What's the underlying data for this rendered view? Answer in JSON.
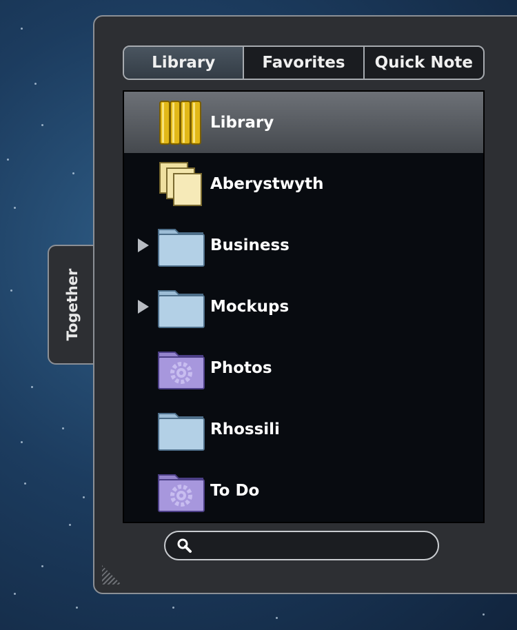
{
  "side_tab": {
    "label": "Together"
  },
  "segments": [
    {
      "label": "Library",
      "selected": true
    },
    {
      "label": "Favorites"
    },
    {
      "label": "Quick Note"
    }
  ],
  "items": [
    {
      "label": "Library",
      "icon": "library-icon",
      "selected": true,
      "expandable": false
    },
    {
      "label": "Aberystwyth",
      "icon": "stacked-notes-icon",
      "expandable": false
    },
    {
      "label": "Business",
      "icon": "blue-folder-icon",
      "expandable": true
    },
    {
      "label": "Mockups",
      "icon": "blue-folder-icon",
      "expandable": true
    },
    {
      "label": "Photos",
      "icon": "smart-folder-icon",
      "expandable": false
    },
    {
      "label": "Rhossili",
      "icon": "blue-folder-icon",
      "expandable": false
    },
    {
      "label": "To Do",
      "icon": "smart-folder-icon",
      "expandable": false
    }
  ],
  "search": {
    "value": "",
    "placeholder": ""
  },
  "colors": {
    "panel": "#2d2f33",
    "library_gold": "#e2b818",
    "folder_blue": "#a9c7de",
    "smart_purple": "#9f8fd6"
  }
}
